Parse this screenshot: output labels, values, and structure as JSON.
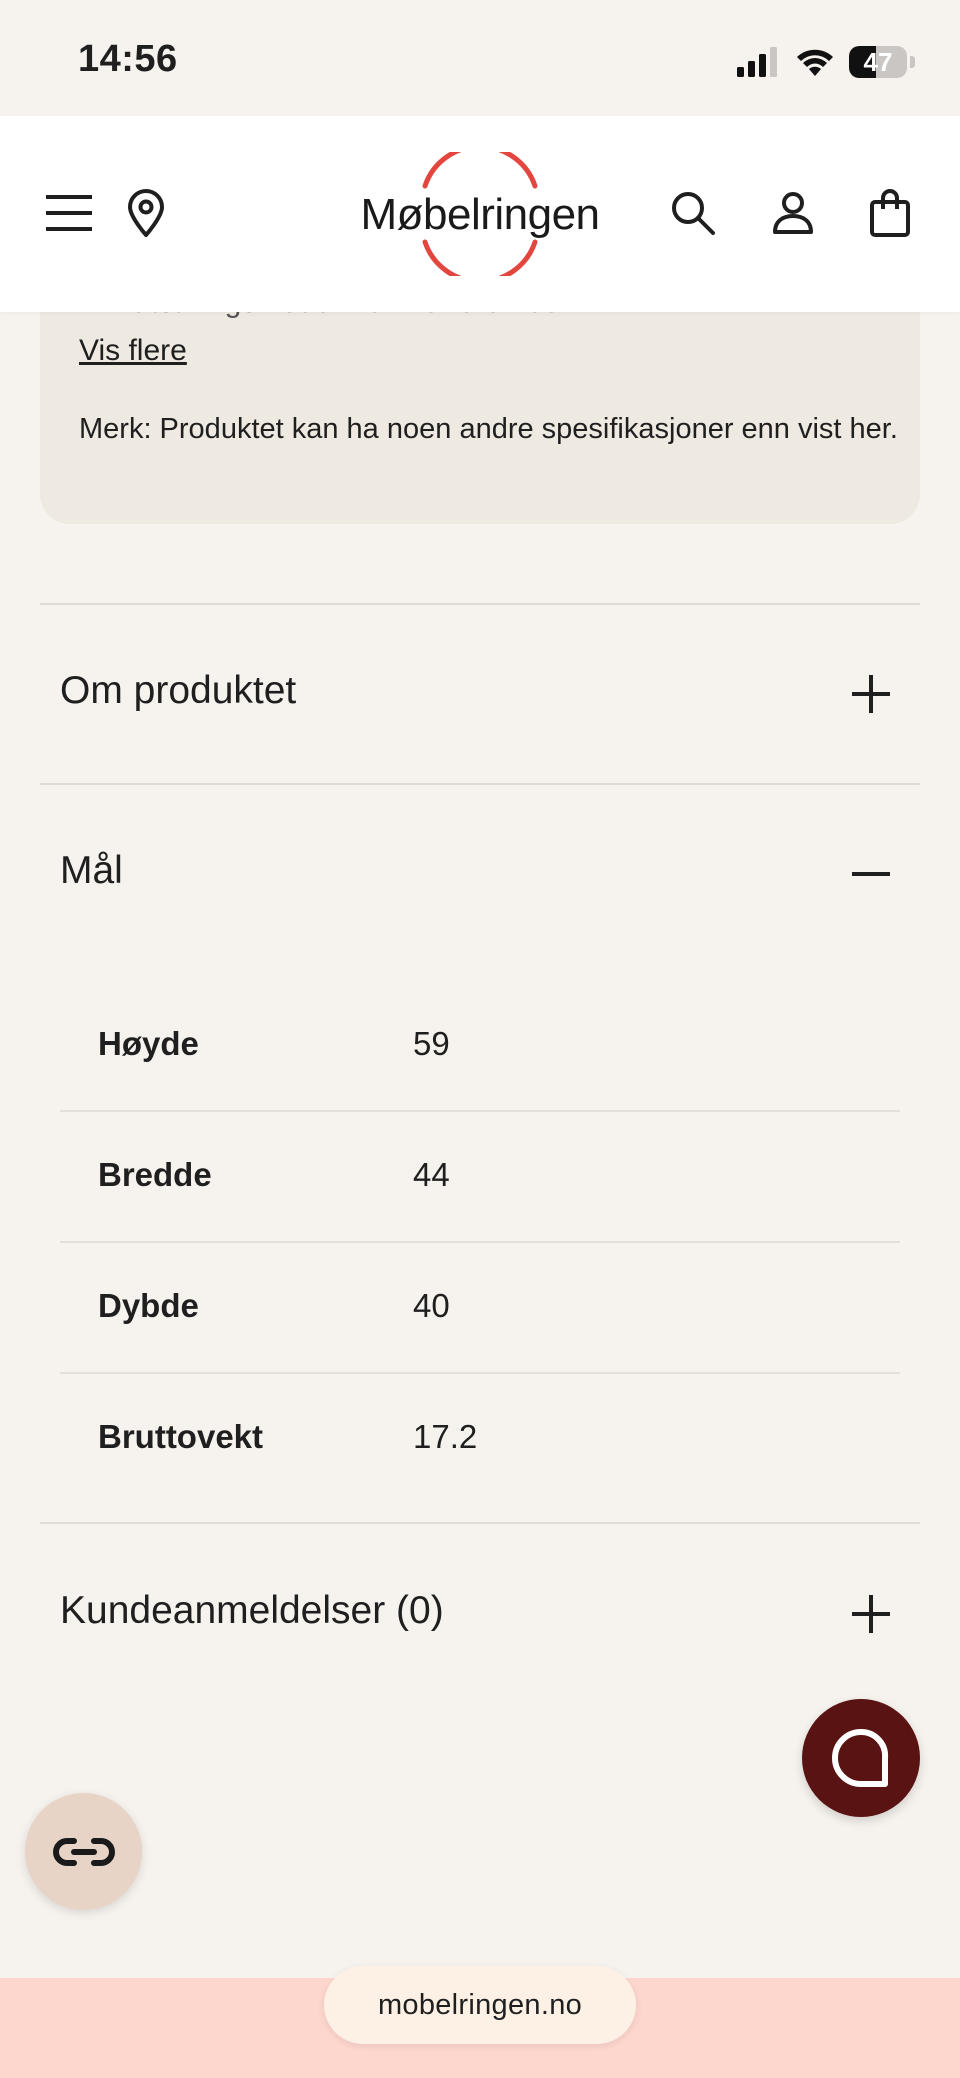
{
  "status_bar": {
    "time": "14:56",
    "battery_level": "47"
  },
  "header": {
    "brand": "Møbelringen",
    "brand_accent_color": "#e2463f",
    "icons": [
      "menu-icon",
      "location-pin-icon",
      "search-icon",
      "user-icon",
      "shopping-bag-icon"
    ]
  },
  "info_card": {
    "cut_text": "Utstillingsmodell kan variere noe.",
    "show_more": "Vis flere",
    "note": "Merk: Produktet kan ha noen andre spesifikasjoner enn vist her."
  },
  "accordion": {
    "about": {
      "title": "Om produktet",
      "expanded": false
    },
    "dimensions": {
      "title": "Mål",
      "expanded": true,
      "rows": [
        {
          "label": "Høyde",
          "value": "59"
        },
        {
          "label": "Bredde",
          "value": "44"
        },
        {
          "label": "Dybde",
          "value": "40"
        },
        {
          "label": "Bruttovekt",
          "value": "17.2"
        }
      ]
    },
    "reviews": {
      "title": "Kundeanmeldelser (0)",
      "expanded": false
    }
  },
  "floating": {
    "chat_icon": "chat-bubble-icon",
    "chat_color": "#5a1313",
    "link_icon": "link-icon"
  },
  "browser": {
    "url": "mobelringen.no"
  }
}
